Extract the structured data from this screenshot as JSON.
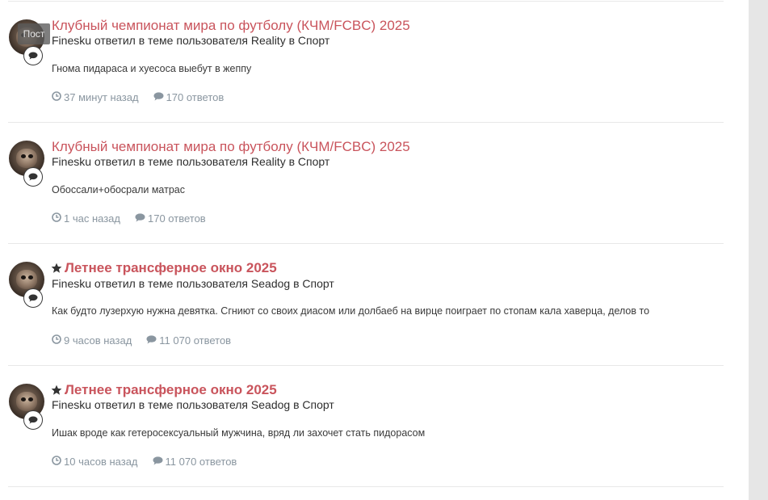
{
  "post_label": "Пост",
  "colors": {
    "title": "#c9545c",
    "meta_stats": "#8a96a0",
    "separator": "#e8e8e8",
    "scrollbar": "#e6e6e6"
  },
  "items": [
    {
      "title": "Клубный чемпионат мира по футболу (КЧМ/FCBC) 2025",
      "featured": false,
      "meta": "Finesku ответил в теме пользователя Reality в Спорт",
      "snippet": "Гнома пидараса и хуесоса выебут в жеппу",
      "time": "37 минут назад",
      "replies": "170 ответов"
    },
    {
      "title": "Клубный чемпионат мира по футболу (КЧМ/FCBC) 2025",
      "featured": false,
      "meta": "Finesku ответил в теме пользователя Reality в Спорт",
      "snippet": "Обоссали+обосрали матрас",
      "time": "1 час назад",
      "replies": "170 ответов"
    },
    {
      "title": "Летнее трансферное окно 2025",
      "featured": true,
      "meta": "Finesku ответил в теме пользователя Seadog в Спорт",
      "snippet": "Как будто лузерхую нужна девятка. Сгниют со своих диасом или долбаеб на вирце поиграет по стопам кала хаверца, делов то",
      "time": "9 часов назад",
      "replies": "11 070 ответов"
    },
    {
      "title": "Летнее трансферное окно 2025",
      "featured": true,
      "meta": "Finesku ответил в теме пользователя Seadog в Спорт",
      "snippet": "Ишак вроде как гетеросексуальный мужчина, вряд ли захочет стать пидорасом",
      "time": "10 часов назад",
      "replies": "11 070 ответов"
    }
  ]
}
